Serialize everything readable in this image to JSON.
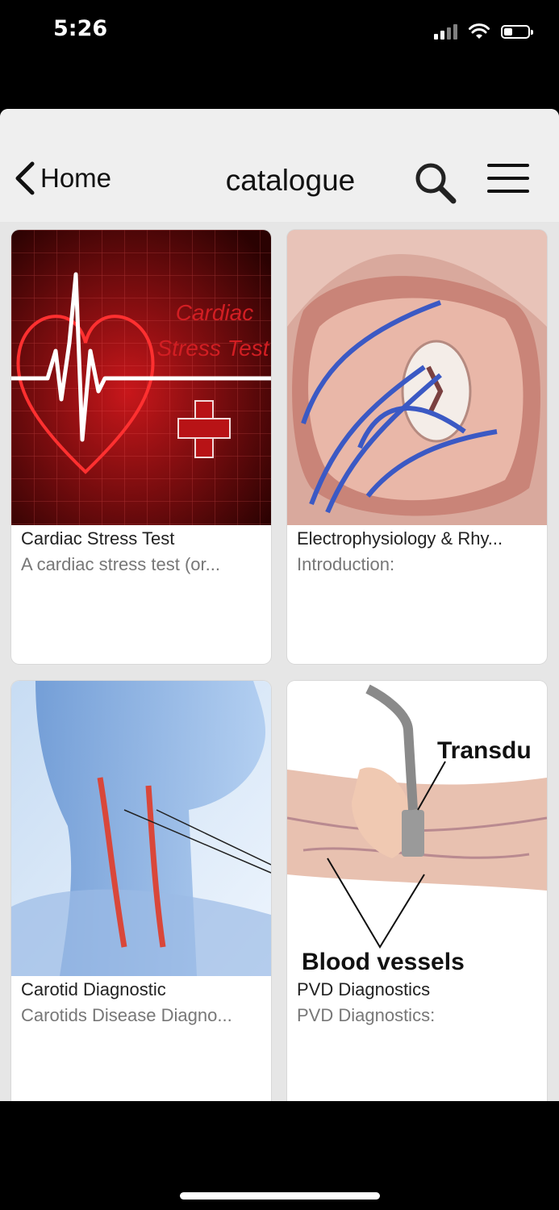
{
  "status_bar": {
    "time": "5:26",
    "signal_icon": "signal-icon",
    "wifi_icon": "wifi-icon",
    "battery_icon": "battery-icon",
    "battery_level": 0.35
  },
  "nav": {
    "back_label": "Home",
    "title": "catalogue",
    "back_icon": "chevron-left-icon",
    "search_icon": "search-icon",
    "menu_icon": "hamburger-menu-icon"
  },
  "thumb_texts": {
    "cardiac_line1": "Cardiac",
    "cardiac_line2": "Stress Test",
    "pvd_label1": "Transdu",
    "pvd_label2": "Blood vessels"
  },
  "cards": [
    {
      "title": "Cardiac Stress Test",
      "subtitle": "A cardiac stress test (or..."
    },
    {
      "title": "Electrophysiology & Rhy...",
      "subtitle": "Introduction:"
    },
    {
      "title": "Carotid Diagnostic",
      "subtitle": "Carotids Disease Diagno..."
    },
    {
      "title": "PVD Diagnostics",
      "subtitle": "PVD Diagnostics:"
    }
  ],
  "colors": {
    "nav_bg": "#efefef",
    "page_bg": "#e6e6e6",
    "card_bg": "#ffffff",
    "accent_red": "#c8171b"
  }
}
